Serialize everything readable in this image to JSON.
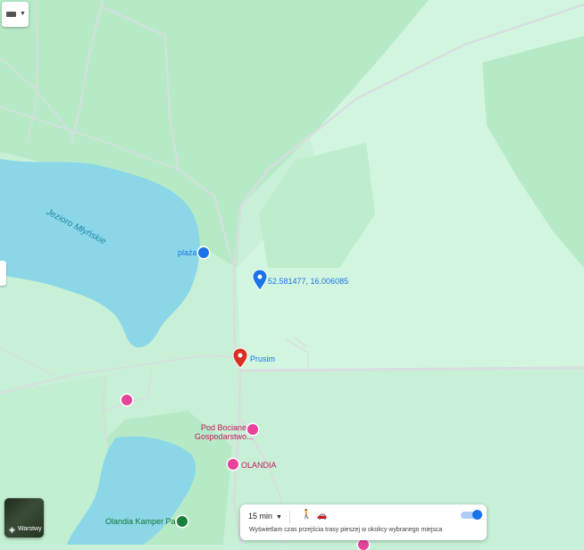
{
  "map": {
    "lake_label": "Jezioro Młyńskie",
    "pois": [
      {
        "id": "plaza",
        "label": "plaża",
        "kind": "beach",
        "color": "#1a73e8"
      },
      {
        "id": "coords",
        "label": "52.581477, 16.006085",
        "kind": "dropped-pin",
        "color": "#1a73e8"
      },
      {
        "id": "prusim",
        "label": "Prusim",
        "kind": "selected-place",
        "color": "#d93025"
      },
      {
        "id": "pod-bocianem",
        "label": "Pod Bocianem\nGospodarstwo...",
        "kind": "lodging",
        "color": "#e8439a"
      },
      {
        "id": "olandia",
        "label": "OLANDIA",
        "kind": "lodging",
        "color": "#e8439a"
      },
      {
        "id": "olandia-kamper",
        "label": "Olandia Kamper Park",
        "kind": "campground",
        "color": "#188038"
      }
    ],
    "colors": {
      "land": "#c8f0d6",
      "forest": "#b3e8c4",
      "water": "#8bd7e8",
      "road": "#d7dde0"
    }
  },
  "controls": {
    "keyboard_icon": "keyboard-icon",
    "layers_label": "Warstwy",
    "layers_icon": "layers-icon"
  },
  "isochrone_panel": {
    "time_select": "15 min",
    "walk_icon": "walk-icon",
    "car_icon": "car-icon",
    "info_text": "Wyświetlam czas przejścia trasy pieszej w okolicy wybranego miejsca",
    "toggle_on": true
  }
}
